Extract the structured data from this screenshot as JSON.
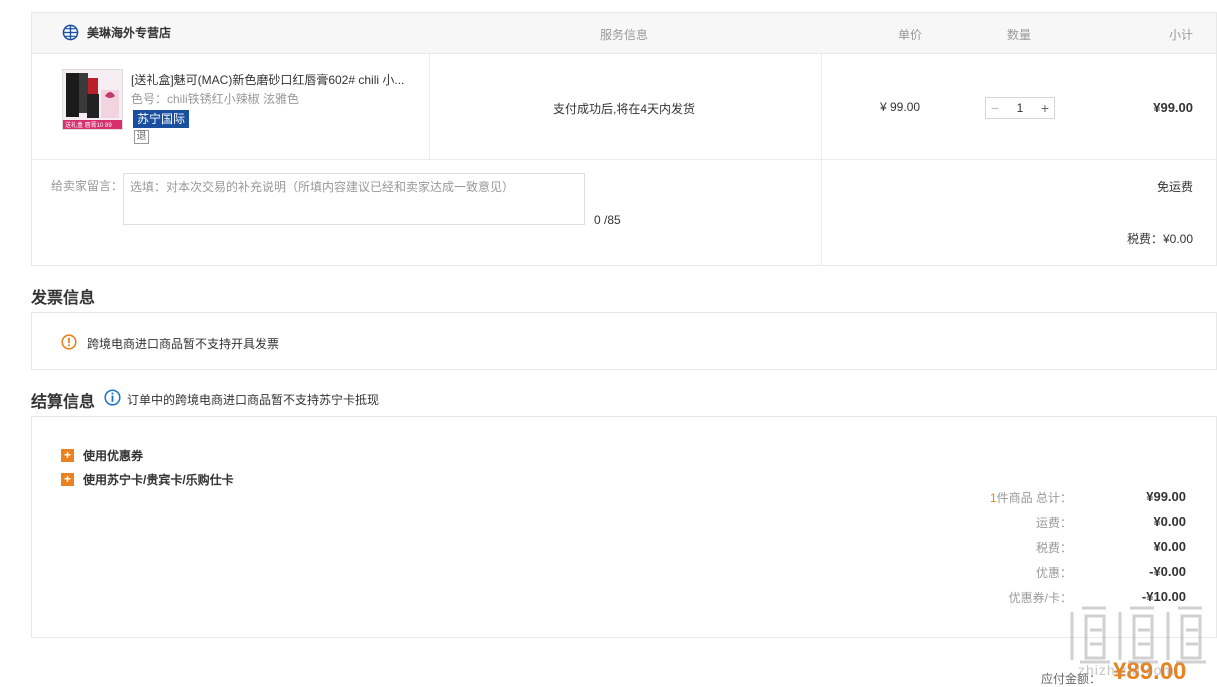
{
  "store": {
    "name": "美琳海外专营店"
  },
  "columns": {
    "service": "服务信息",
    "price": "单价",
    "qty": "数量",
    "subtotal": "小计"
  },
  "item": {
    "title": "[送礼盒]魅可(MAC)新色磨砂口红唇膏602# chili 小...",
    "color": "色号：chili铁锈红小辣椒 泫雅色",
    "tag_intl": "苏宁国际",
    "tag_return": "退",
    "service": "支付成功后,将在4天内发货",
    "price": "¥ 99.00",
    "qty": "1",
    "subtotal": "¥99.00",
    "thumb_caption": "送礼盒  唇膏10  89"
  },
  "message": {
    "label": "给卖家留言：",
    "placeholder": "选填：对本次交易的补充说明（所填内容建议已经和卖家达成一致意见）",
    "count": "0 /85"
  },
  "shipping": {
    "free": "免运费",
    "tax": "税费：¥0.00"
  },
  "invoice": {
    "title": "发票信息",
    "text": "跨境电商进口商品暂不支持开具发票"
  },
  "settle": {
    "title": "结算信息",
    "note": "订单中的跨境电商进口商品暂不支持苏宁卡抵现",
    "options": [
      {
        "label": "使用优惠券"
      },
      {
        "label": "使用苏宁卡/贵宾卡/乐购仕卡"
      }
    ],
    "summary_count": "1",
    "summary_first_label": "件商品 总计：",
    "summary": [
      {
        "label": "",
        "value": "¥99.00"
      },
      {
        "label": "运费：",
        "value": "¥0.00"
      },
      {
        "label": "税费：",
        "value": "¥0.00"
      },
      {
        "label": "优惠：",
        "value": "-¥0.00"
      },
      {
        "label": "优惠券/卡：",
        "value": "-¥10.00"
      }
    ]
  },
  "payment": {
    "label": "应付金额：",
    "value": "¥89.00"
  },
  "watermark": {
    "text": "zhizhizhi.com"
  },
  "colors": {
    "accent": "#e9821f",
    "tag_blue": "#1a4fa0",
    "info_blue": "#1a73c8"
  }
}
